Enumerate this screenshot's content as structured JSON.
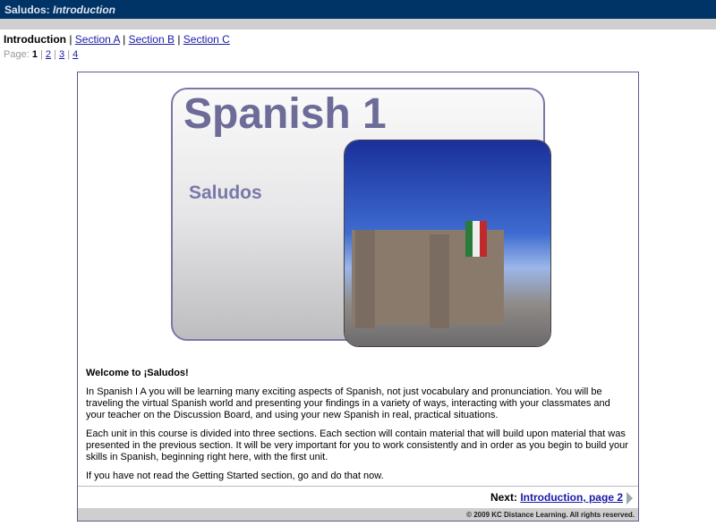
{
  "title": {
    "course": "Saludos:",
    "page": "Introduction"
  },
  "nav": {
    "current": "Introduction",
    "links": [
      "Section A",
      "Section B",
      "Section C"
    ]
  },
  "pages": {
    "label": "Page:",
    "current": "1",
    "links": [
      "2",
      "3",
      "4"
    ]
  },
  "hero": {
    "title": "Spanish 1",
    "subtitle": "Saludos"
  },
  "content": {
    "heading": "Welcome to ¡Saludos!",
    "paragraphs": [
      "In Spanish I A you will be learning many exciting aspects of Spanish, not just vocabulary and pronunciation.  You will be traveling the virtual Spanish world and presenting your findings in a variety of ways, interacting with your classmates and your teacher on the Discussion Board, and using your new Spanish in real, practical situations.",
      "Each unit in this course is divided into three sections. Each section will contain material that will build upon material that was presented in the previous section. It will be very important for you to work consistently and in order as you begin to build your skills in Spanish, beginning right here, with the first unit.",
      "If you have not read the Getting Started section, go and do that now."
    ]
  },
  "next": {
    "label": "Next:",
    "link": "Introduction, page 2"
  },
  "footer": "© 2009 KC Distance Learning. All rights reserved."
}
